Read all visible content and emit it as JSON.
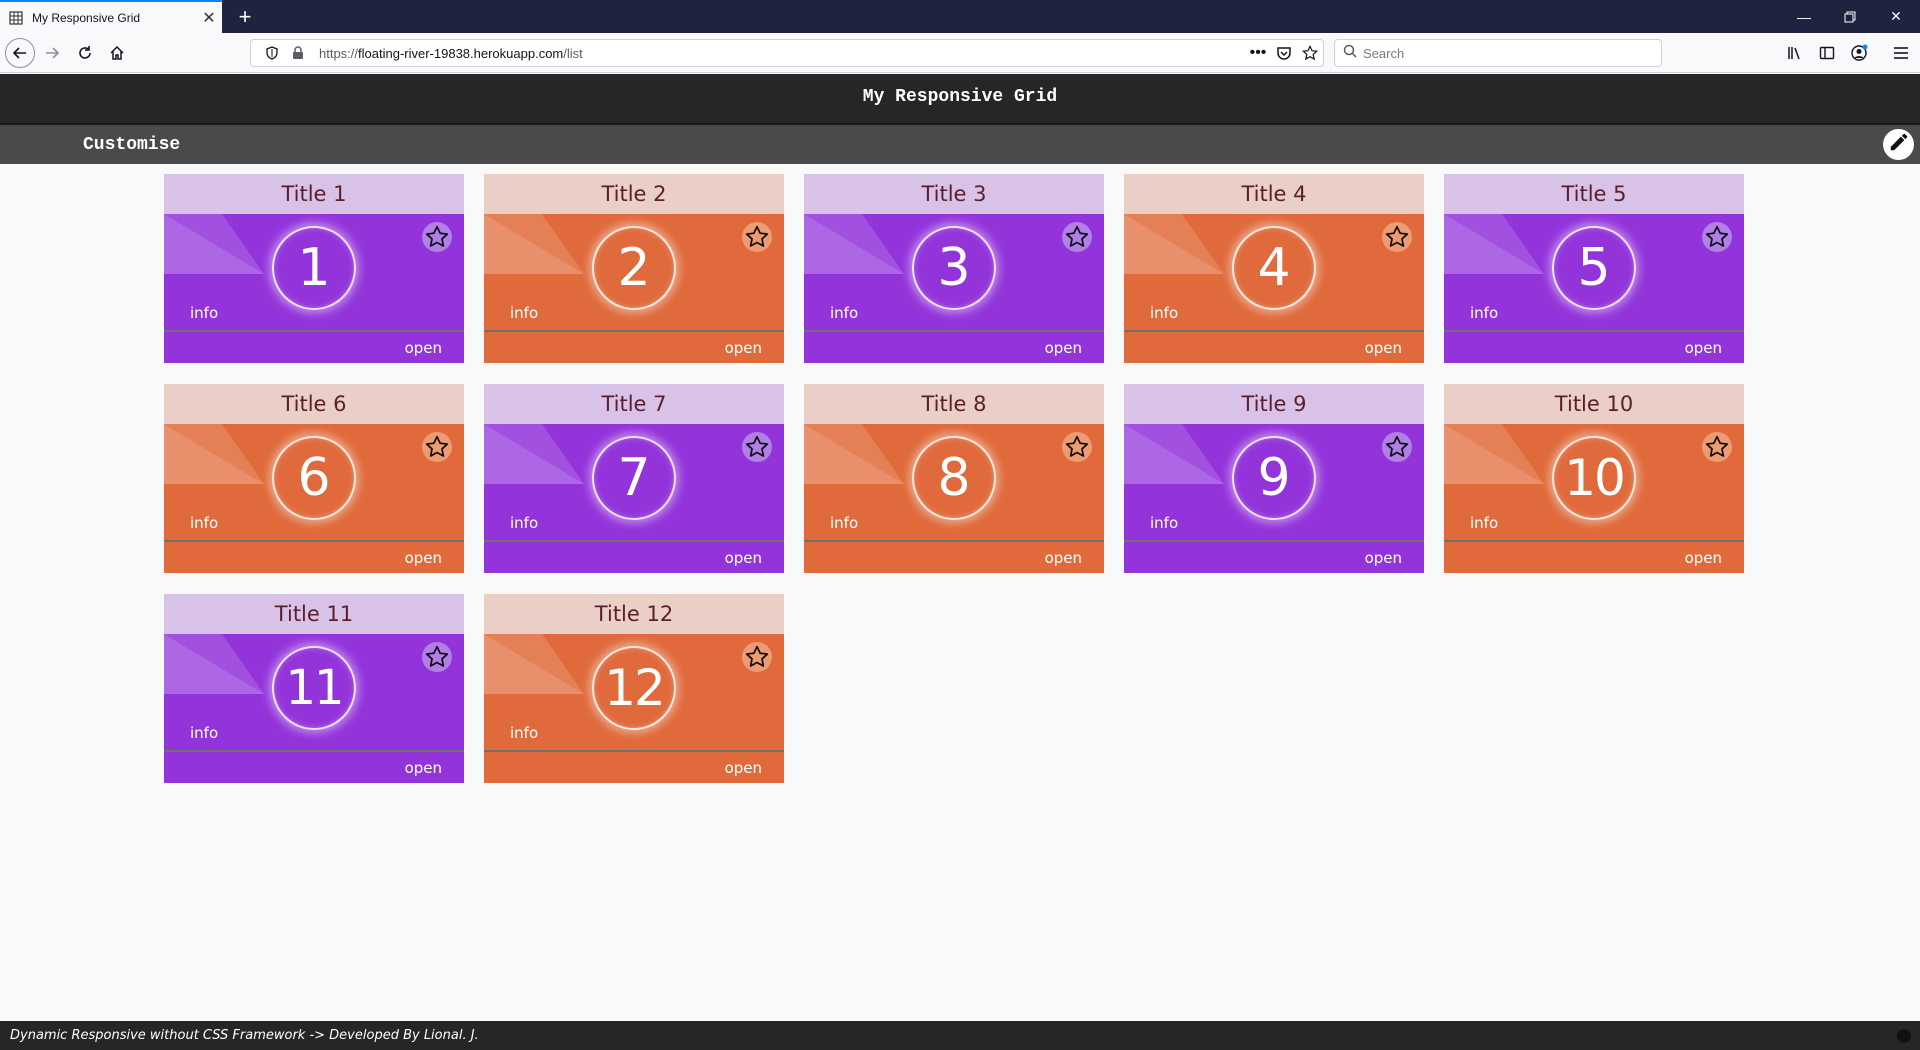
{
  "browser": {
    "tab_title": "My Responsive Grid",
    "url_scheme": "https://",
    "url_host": "floating-river-19838.herokuapp.com",
    "url_path": "/list",
    "search_placeholder": "Search",
    "icons": [
      "grid-favicon",
      "close-icon",
      "plus-icon",
      "minimize-icon",
      "restore-icon",
      "close-window-icon",
      "back-icon",
      "forward-icon",
      "reload-icon",
      "home-icon",
      "shield-icon",
      "lock-icon",
      "more-icon",
      "pocket-icon",
      "bookmark-star-icon",
      "search-icon",
      "library-icon",
      "sidebar-icon",
      "account-icon",
      "menu-icon"
    ]
  },
  "app": {
    "title": "My Responsive Grid",
    "customise_label": "Customise",
    "edit_icon": "pencil-icon",
    "footer_text": "Dynamic Responsive without CSS Framework -> Developed By Lional. J."
  },
  "colors": {
    "purple": "#9334db",
    "orange": "#e06a3b",
    "purple_header": "#d8c2e8",
    "orange_header": "#e9cfc5",
    "title_text": "#5a1f2a"
  },
  "cards": [
    {
      "title": "Title 1",
      "number": "1",
      "color": "purple",
      "info": "info",
      "open": "open"
    },
    {
      "title": "Title 2",
      "number": "2",
      "color": "orange",
      "info": "info",
      "open": "open"
    },
    {
      "title": "Title 3",
      "number": "3",
      "color": "purple",
      "info": "info",
      "open": "open"
    },
    {
      "title": "Title 4",
      "number": "4",
      "color": "orange",
      "info": "info",
      "open": "open"
    },
    {
      "title": "Title 5",
      "number": "5",
      "color": "purple",
      "info": "info",
      "open": "open"
    },
    {
      "title": "Title 6",
      "number": "6",
      "color": "orange",
      "info": "info",
      "open": "open"
    },
    {
      "title": "Title 7",
      "number": "7",
      "color": "purple",
      "info": "info",
      "open": "open"
    },
    {
      "title": "Title 8",
      "number": "8",
      "color": "orange",
      "info": "info",
      "open": "open"
    },
    {
      "title": "Title 9",
      "number": "9",
      "color": "purple",
      "info": "info",
      "open": "open"
    },
    {
      "title": "Title 10",
      "number": "10",
      "color": "orange",
      "info": "info",
      "open": "open"
    },
    {
      "title": "Title 11",
      "number": "11",
      "color": "purple",
      "info": "info",
      "open": "open"
    },
    {
      "title": "Title 12",
      "number": "12",
      "color": "orange",
      "info": "info",
      "open": "open"
    }
  ]
}
